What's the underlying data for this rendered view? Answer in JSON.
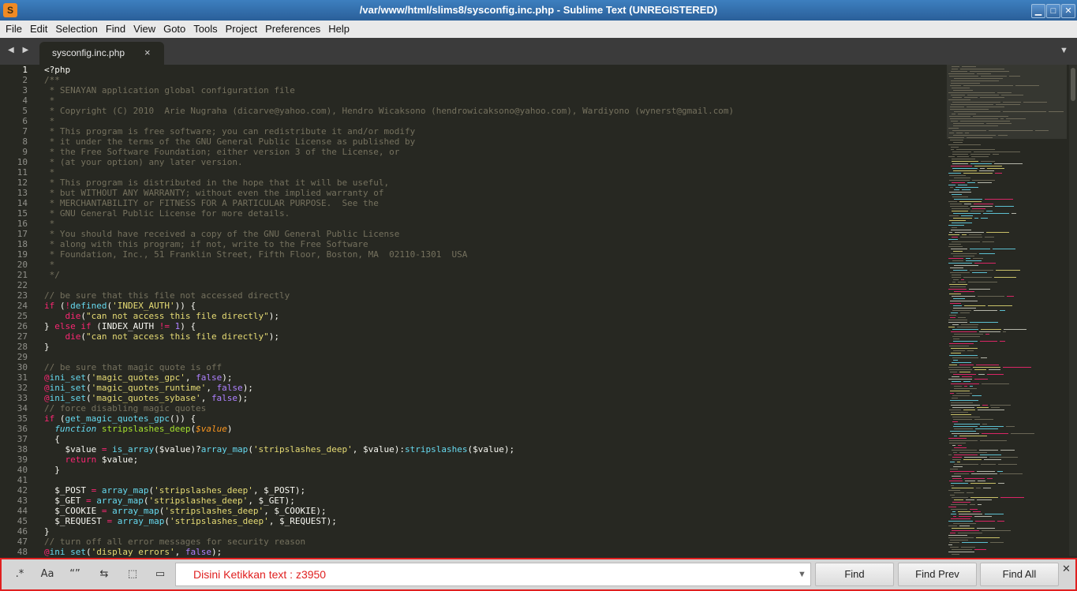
{
  "window": {
    "title": "/var/www/html/slims8/sysconfig.inc.php - Sublime Text (UNREGISTERED)",
    "app_icon_glyph": "S",
    "controls": {
      "minimize": "▁",
      "maximize": "□",
      "close": "✕"
    }
  },
  "menu": [
    "File",
    "Edit",
    "Selection",
    "Find",
    "View",
    "Goto",
    "Tools",
    "Project",
    "Preferences",
    "Help"
  ],
  "tabs": {
    "nav": "◀ ▶",
    "active": {
      "label": "sysconfig.inc.php",
      "close": "×"
    },
    "dropdown": "▼"
  },
  "editor": {
    "current_line": 1,
    "lines": [
      [
        {
          "t": "<?php",
          "c": ""
        }
      ],
      [
        {
          "t": "/**",
          "c": "c"
        }
      ],
      [
        {
          "t": " * SENAYAN application global configuration file",
          "c": "c"
        }
      ],
      [
        {
          "t": " *",
          "c": "c"
        }
      ],
      [
        {
          "t": " * Copyright (C) 2010  Arie Nugraha (dicarve@yahoo.com), Hendro Wicaksono (hendrowicaksono@yahoo.com), Wardiyono (wynerst@gmail.com)",
          "c": "c"
        }
      ],
      [
        {
          "t": " *",
          "c": "c"
        }
      ],
      [
        {
          "t": " * This program is free software; you can redistribute it and/or modify",
          "c": "c"
        }
      ],
      [
        {
          "t": " * it under the terms of the GNU General Public License as published by",
          "c": "c"
        }
      ],
      [
        {
          "t": " * the Free Software Foundation; either version 3 of the License, or",
          "c": "c"
        }
      ],
      [
        {
          "t": " * (at your option) any later version.",
          "c": "c"
        }
      ],
      [
        {
          "t": " *",
          "c": "c"
        }
      ],
      [
        {
          "t": " * This program is distributed in the hope that it will be useful,",
          "c": "c"
        }
      ],
      [
        {
          "t": " * but WITHOUT ANY WARRANTY; without even the implied warranty of",
          "c": "c"
        }
      ],
      [
        {
          "t": " * MERCHANTABILITY or FITNESS FOR A PARTICULAR PURPOSE.  See the",
          "c": "c"
        }
      ],
      [
        {
          "t": " * GNU General Public License for more details.",
          "c": "c"
        }
      ],
      [
        {
          "t": " *",
          "c": "c"
        }
      ],
      [
        {
          "t": " * You should have received a copy of the GNU General Public License",
          "c": "c"
        }
      ],
      [
        {
          "t": " * along with this program; if not, write to the Free Software",
          "c": "c"
        }
      ],
      [
        {
          "t": " * Foundation, Inc., 51 Franklin Street, Fifth Floor, Boston, MA  02110-1301  USA",
          "c": "c"
        }
      ],
      [
        {
          "t": " *",
          "c": "c"
        }
      ],
      [
        {
          "t": " */",
          "c": "c"
        }
      ],
      [],
      [
        {
          "t": "// be sure that this file not accessed directly",
          "c": "c"
        }
      ],
      [
        {
          "t": "if",
          "c": "k"
        },
        {
          "t": " (",
          "c": ""
        },
        {
          "t": "!",
          "c": "k"
        },
        {
          "t": "defined",
          "c": "f"
        },
        {
          "t": "(",
          "c": ""
        },
        {
          "t": "'INDEX_AUTH'",
          "c": "s"
        },
        {
          "t": ")) {",
          "c": ""
        }
      ],
      [
        {
          "t": "    ",
          "c": ""
        },
        {
          "t": "die",
          "c": "k"
        },
        {
          "t": "(",
          "c": ""
        },
        {
          "t": "\"can not access this file directly\"",
          "c": "s"
        },
        {
          "t": ");",
          "c": ""
        }
      ],
      [
        {
          "t": "} ",
          "c": ""
        },
        {
          "t": "else if",
          "c": "k"
        },
        {
          "t": " (INDEX_AUTH ",
          "c": ""
        },
        {
          "t": "!=",
          "c": "k"
        },
        {
          "t": " ",
          "c": ""
        },
        {
          "t": "1",
          "c": "n"
        },
        {
          "t": ") {",
          "c": ""
        }
      ],
      [
        {
          "t": "    ",
          "c": ""
        },
        {
          "t": "die",
          "c": "k"
        },
        {
          "t": "(",
          "c": ""
        },
        {
          "t": "\"can not access this file directly\"",
          "c": "s"
        },
        {
          "t": ");",
          "c": ""
        }
      ],
      [
        {
          "t": "}",
          "c": ""
        }
      ],
      [],
      [
        {
          "t": "// be sure that magic quote is off",
          "c": "c"
        }
      ],
      [
        {
          "t": "@",
          "c": "k"
        },
        {
          "t": "ini_set",
          "c": "f"
        },
        {
          "t": "(",
          "c": ""
        },
        {
          "t": "'magic_quotes_gpc'",
          "c": "s"
        },
        {
          "t": ", ",
          "c": ""
        },
        {
          "t": "false",
          "c": "n"
        },
        {
          "t": ");",
          "c": ""
        }
      ],
      [
        {
          "t": "@",
          "c": "k"
        },
        {
          "t": "ini_set",
          "c": "f"
        },
        {
          "t": "(",
          "c": ""
        },
        {
          "t": "'magic_quotes_runtime'",
          "c": "s"
        },
        {
          "t": ", ",
          "c": ""
        },
        {
          "t": "false",
          "c": "n"
        },
        {
          "t": ");",
          "c": ""
        }
      ],
      [
        {
          "t": "@",
          "c": "k"
        },
        {
          "t": "ini_set",
          "c": "f"
        },
        {
          "t": "(",
          "c": ""
        },
        {
          "t": "'magic_quotes_sybase'",
          "c": "s"
        },
        {
          "t": ", ",
          "c": ""
        },
        {
          "t": "false",
          "c": "n"
        },
        {
          "t": ");",
          "c": ""
        }
      ],
      [
        {
          "t": "// force disabling magic quotes",
          "c": "c"
        }
      ],
      [
        {
          "t": "if",
          "c": "k"
        },
        {
          "t": " (",
          "c": ""
        },
        {
          "t": "get_magic_quotes_gpc",
          "c": "f"
        },
        {
          "t": "()) {",
          "c": ""
        }
      ],
      [
        {
          "t": "  ",
          "c": ""
        },
        {
          "t": "function",
          "c": "fi"
        },
        {
          "t": " ",
          "c": ""
        },
        {
          "t": "stripslashes_deep",
          "c": "g"
        },
        {
          "t": "(",
          "c": ""
        },
        {
          "t": "$value",
          "c": "pa"
        },
        {
          "t": ")",
          "c": ""
        }
      ],
      [
        {
          "t": "  {",
          "c": ""
        }
      ],
      [
        {
          "t": "    $value ",
          "c": ""
        },
        {
          "t": "=",
          "c": "k"
        },
        {
          "t": " ",
          "c": ""
        },
        {
          "t": "is_array",
          "c": "f"
        },
        {
          "t": "($value)?",
          "c": ""
        },
        {
          "t": "array_map",
          "c": "f"
        },
        {
          "t": "(",
          "c": ""
        },
        {
          "t": "'stripslashes_deep'",
          "c": "s"
        },
        {
          "t": ", $value):",
          "c": ""
        },
        {
          "t": "stripslashes",
          "c": "f"
        },
        {
          "t": "($value);",
          "c": ""
        }
      ],
      [
        {
          "t": "    ",
          "c": ""
        },
        {
          "t": "return",
          "c": "k"
        },
        {
          "t": " $value;",
          "c": ""
        }
      ],
      [
        {
          "t": "  }",
          "c": ""
        }
      ],
      [],
      [
        {
          "t": "  $_POST ",
          "c": ""
        },
        {
          "t": "=",
          "c": "k"
        },
        {
          "t": " ",
          "c": ""
        },
        {
          "t": "array_map",
          "c": "f"
        },
        {
          "t": "(",
          "c": ""
        },
        {
          "t": "'stripslashes_deep'",
          "c": "s"
        },
        {
          "t": ", $_POST);",
          "c": ""
        }
      ],
      [
        {
          "t": "  $_GET ",
          "c": ""
        },
        {
          "t": "=",
          "c": "k"
        },
        {
          "t": " ",
          "c": ""
        },
        {
          "t": "array_map",
          "c": "f"
        },
        {
          "t": "(",
          "c": ""
        },
        {
          "t": "'stripslashes_deep'",
          "c": "s"
        },
        {
          "t": ", $_GET);",
          "c": ""
        }
      ],
      [
        {
          "t": "  $_COOKIE ",
          "c": ""
        },
        {
          "t": "=",
          "c": "k"
        },
        {
          "t": " ",
          "c": ""
        },
        {
          "t": "array_map",
          "c": "f"
        },
        {
          "t": "(",
          "c": ""
        },
        {
          "t": "'stripslashes_deep'",
          "c": "s"
        },
        {
          "t": ", $_COOKIE);",
          "c": ""
        }
      ],
      [
        {
          "t": "  $_REQUEST ",
          "c": ""
        },
        {
          "t": "=",
          "c": "k"
        },
        {
          "t": " ",
          "c": ""
        },
        {
          "t": "array_map",
          "c": "f"
        },
        {
          "t": "(",
          "c": ""
        },
        {
          "t": "'stripslashes_deep'",
          "c": "s"
        },
        {
          "t": ", $_REQUEST);",
          "c": ""
        }
      ],
      [
        {
          "t": "}",
          "c": ""
        }
      ],
      [
        {
          "t": "// turn off all error messages for security reason",
          "c": "c"
        }
      ],
      [
        {
          "t": "@",
          "c": "k"
        },
        {
          "t": "ini_set",
          "c": "f"
        },
        {
          "t": "(",
          "c": ""
        },
        {
          "t": "'display_errors'",
          "c": "s"
        },
        {
          "t": ", ",
          "c": ""
        },
        {
          "t": "false",
          "c": "n"
        },
        {
          "t": ");",
          "c": ""
        }
      ]
    ]
  },
  "find_panel": {
    "options": [
      {
        "name": "regex-toggle",
        "glyph": ".*"
      },
      {
        "name": "case-sensitive-toggle",
        "glyph": "Aa"
      },
      {
        "name": "whole-word-toggle",
        "glyph": "“”"
      },
      {
        "name": "wrap-toggle",
        "glyph": "⇆"
      },
      {
        "name": "in-selection-toggle",
        "glyph": "⬚"
      },
      {
        "name": "highlight-matches-toggle",
        "glyph": "▭"
      }
    ],
    "input_value": "Disini Ketikkan text : z3950",
    "dropdown_icon": "▼",
    "buttons": {
      "find": "Find",
      "find_prev": "Find Prev",
      "find_all": "Find All"
    },
    "close": "✕"
  },
  "colors": {
    "background": "#272822",
    "comment": "#75715e",
    "keyword": "#f92672",
    "string": "#e6db74",
    "number": "#ae81ff",
    "function": "#66d9ef",
    "highlight_border": "#e02020"
  }
}
